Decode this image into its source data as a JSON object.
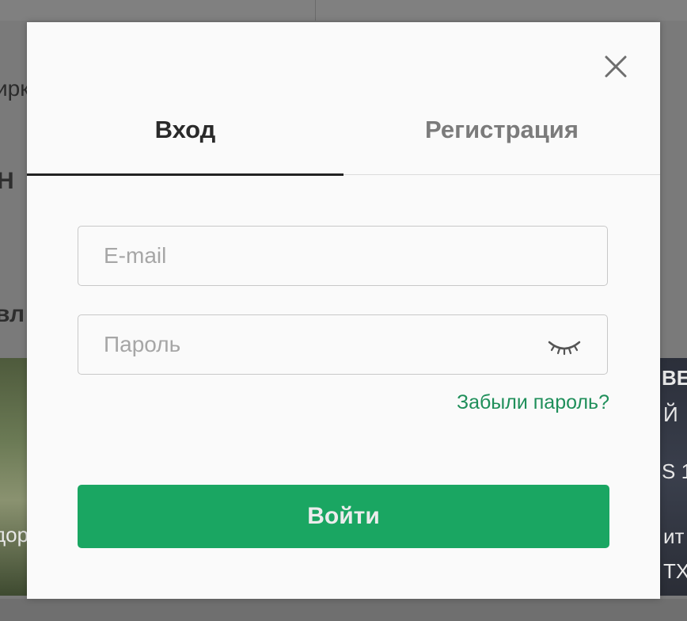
{
  "background_page": {
    "fragments": {
      "left_1": "ирк",
      "left_2": "Н",
      "left_3": "вл",
      "left_img_caption": "дор",
      "right_1": "ВЕ",
      "right_2": "Й",
      "right_3": "S 1",
      "right_4": "ит",
      "right_5": "ТХ"
    }
  },
  "modal": {
    "close_icon": "close-icon",
    "tabs": [
      {
        "label": "Вход",
        "active": true
      },
      {
        "label": "Регистрация",
        "active": false
      }
    ],
    "email": {
      "placeholder": "E-mail",
      "value": ""
    },
    "password": {
      "placeholder": "Пароль",
      "value": "",
      "toggle_icon": "eye-closed-icon"
    },
    "forgot_password": "Забыли пароль?",
    "submit_label": "Войти"
  },
  "colors": {
    "accent_green": "#1aa662",
    "link_green": "#1f8f5a",
    "active_tab_text": "#2a2a2a",
    "inactive_tab_text": "#7b7b7b"
  }
}
